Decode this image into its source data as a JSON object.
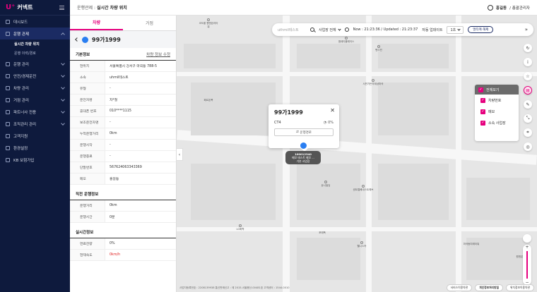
{
  "app": {
    "logo_text": "커넥트"
  },
  "header": {
    "breadcrumb_parent": "운행관제 :",
    "breadcrumb_current": "실시간 차량 위치",
    "user_name": "홍길동",
    "user_role": "/ 총괄관리자"
  },
  "sidebar": {
    "items": [
      {
        "label": "대시보드",
        "icon": "dashboard-icon"
      },
      {
        "label": "운행 관제",
        "icon": "monitor-icon",
        "active": true
      },
      {
        "label": "운행 관리",
        "icon": "route-icon"
      },
      {
        "label": "안전/경제운전",
        "icon": "shield-icon"
      },
      {
        "label": "차량 관리",
        "icon": "car-icon"
      },
      {
        "label": "거점 관리",
        "icon": "location-icon"
      },
      {
        "label": "파트너사 전용",
        "icon": "partner-icon"
      },
      {
        "label": "조직관리 관리",
        "icon": "org-icon"
      },
      {
        "label": "고객지원",
        "icon": "support-icon"
      },
      {
        "label": "환경설정",
        "icon": "settings-icon"
      },
      {
        "label": "KB 보험가입",
        "icon": "insurance-icon"
      }
    ],
    "sub_items": [
      "실시간 차량 위치",
      "운행 이력/경로"
    ]
  },
  "panel": {
    "tabs": [
      "차량",
      "거점"
    ],
    "vehicle_no": "99가1999",
    "basic": {
      "title": "기본정보",
      "edit_link": "차량 정보 수정",
      "rows": [
        {
          "k": "현위치",
          "v": "서울특별시 강서구 마곡동 788-5"
        },
        {
          "k": "소속",
          "v": "uhmil테스트"
        },
        {
          "k": "유형",
          "v": "-"
        },
        {
          "k": "운전자명",
          "v": "차*철"
        },
        {
          "k": "휴대폰 번호",
          "v": "010****1115"
        },
        {
          "k": "보조운전자명",
          "v": "-"
        },
        {
          "k": "누적운행거리",
          "v": "0km"
        },
        {
          "k": "운행시작",
          "v": "-"
        },
        {
          "k": "운행종료",
          "v": "-"
        },
        {
          "k": "단말번호",
          "v": "567624063343369"
        },
        {
          "k": "메모",
          "v": "홍길동"
        }
      ]
    },
    "recent": {
      "title": "직전 운행정보",
      "rows": [
        {
          "k": "운행거리",
          "v": "0km"
        },
        {
          "k": "운행시간",
          "v": "0분"
        }
      ]
    },
    "live": {
      "title": "실시간정보",
      "rows": [
        {
          "k": "연료잔량",
          "v": "0%"
        },
        {
          "k": "현재속도",
          "v": "0km/h",
          "red": true
        }
      ]
    }
  },
  "map": {
    "search_placeholder": "uthmil테스트",
    "site_select": "사업장 전체",
    "now_text": "Now : 21:23:36 / Updated : 21:23:37",
    "auto_update_label": "자동 업데이트",
    "interval": "1초",
    "multi_btn": "멀티캐 해제",
    "layer": {
      "head": "전체보기",
      "items": [
        "차량번호",
        "메모",
        "소속 사업장"
      ]
    },
    "popup": {
      "title": "99가1999",
      "model": "CT4",
      "fuel": "0%",
      "button": "운행경로"
    },
    "marker": {
      "line1": "100012340",
      "line2": "메모 테스트 메모 ...",
      "line3": "기본 사업장"
    },
    "pois": [
      "코오롱 원앤온리타워",
      "엠테이플레이스",
      "펜스빈",
      "서반가든의세상마곡",
      "페르몬폭",
      "마곡동미래타워",
      "유니빌딩",
      "센트럴베네스트에브",
      "LG화학",
      "포레폭",
      "웰니스카",
      "원앤온리"
    ],
    "footer_info": "사업자등록번호 : 2208139938   통신판매신고 : 제 2015-서울용산-00481호   고객센터 : 1544-0010",
    "footer_btns": [
      "서비스이용약관",
      "개인정보처리방침",
      "위치정보이용약관"
    ]
  },
  "colors": {
    "brand": "#e6007e",
    "sidebar_bg": "#0e1a3d",
    "marker": "#2a7ef1"
  }
}
